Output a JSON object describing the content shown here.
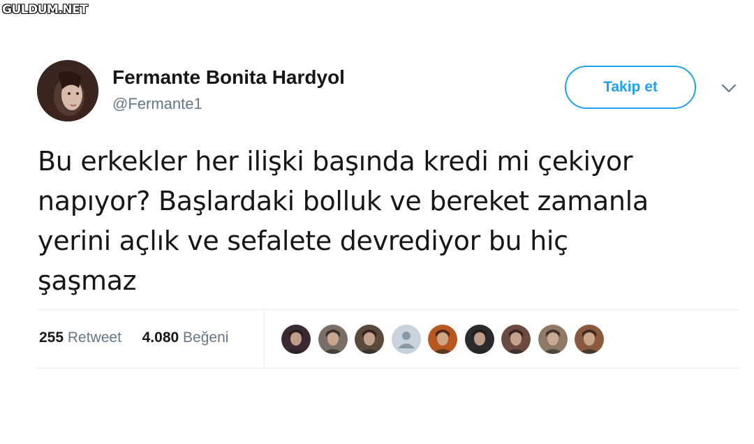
{
  "watermark": "GULDUM.NET",
  "author": {
    "name": "Fermante Bonita Hardyol",
    "handle": "@Fermante1"
  },
  "follow_button": "Takip et",
  "tweet": {
    "text_lines": [
      "Bu erkekler her ilişki başında kredi mi çekiyor",
      "napıyor? Başlardaki bolluk ve bereket zamanla",
      "yerini açlık ve sefalete devrediyor bu hiç",
      "şaşmaz"
    ]
  },
  "stats": {
    "retweet_count": "255",
    "retweet_label": "Retweet",
    "like_count": "4.080",
    "like_label": "Beğeni"
  },
  "likers": [
    {
      "icon": "woman-dark-hair-avatar",
      "color": "#3a2a33"
    },
    {
      "icon": "man-cap-avatar",
      "color": "#7b6e66"
    },
    {
      "icon": "man-bearded-avatar",
      "color": "#5a4a3c"
    },
    {
      "icon": "default-user-avatar",
      "color": "#c9d3db"
    },
    {
      "icon": "woman-red-hair-avatar",
      "color": "#b8571f"
    },
    {
      "icon": "man-dark-avatar",
      "color": "#2b2b2e"
    },
    {
      "icon": "man-tattoo-avatar",
      "color": "#6b4b3f"
    },
    {
      "icon": "woman-beach-avatar",
      "color": "#8f7a68"
    },
    {
      "icon": "woman-brown-hair-avatar",
      "color": "#8a5a3e"
    }
  ],
  "colors": {
    "accent": "#1da1f2",
    "text": "#14171a",
    "muted": "#657786",
    "divider": "#e6ecf0"
  }
}
